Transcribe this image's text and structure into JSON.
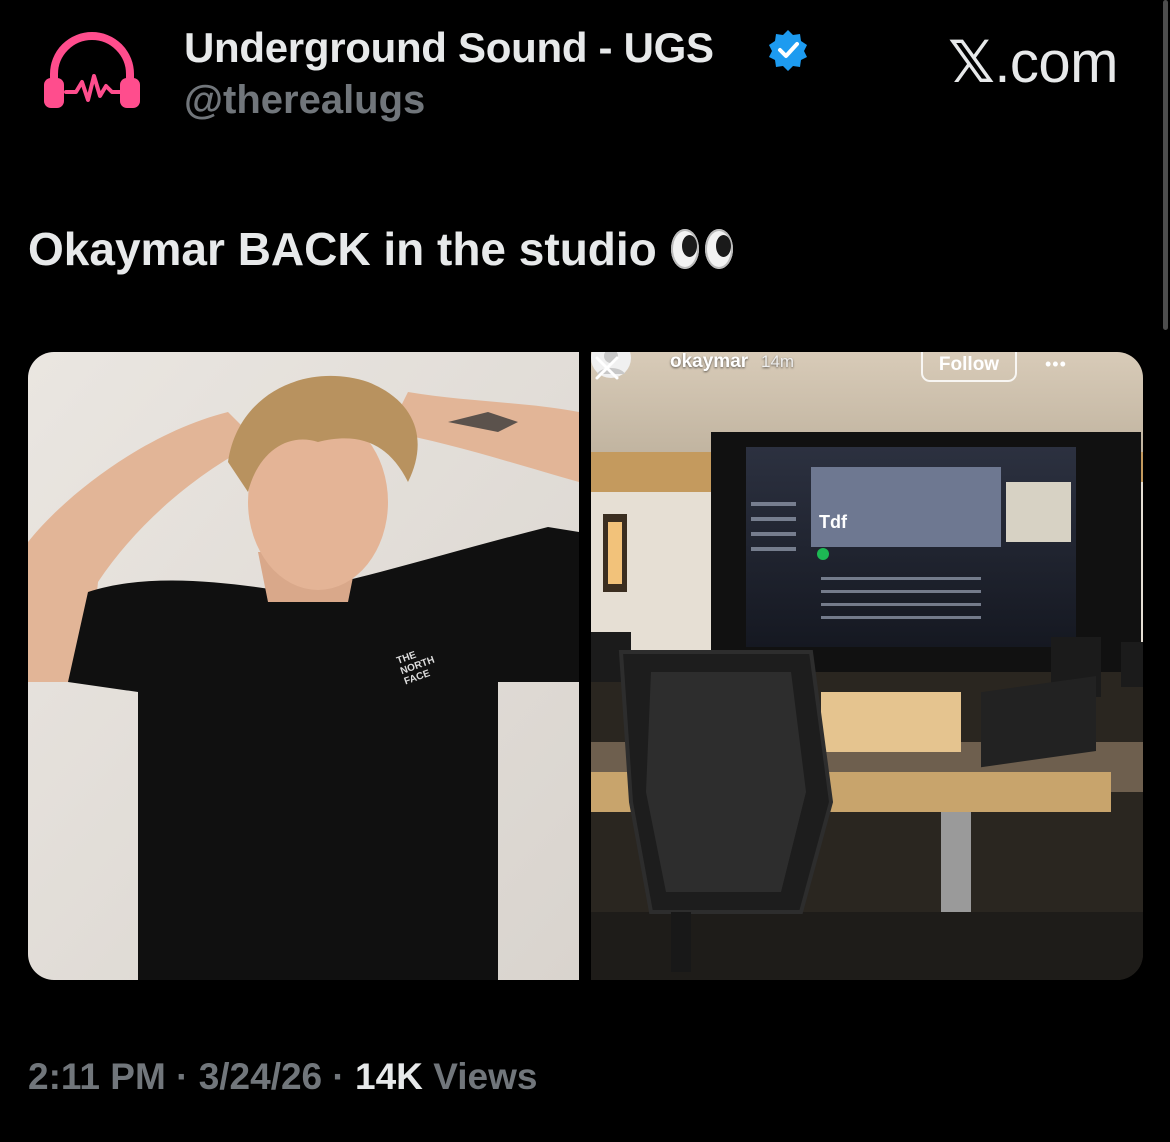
{
  "header": {
    "display_name": "Underground Sound - UGS",
    "handle": "@therealugs",
    "brand": "X.com",
    "avatar_icon": "headphones-waveform-icon",
    "verified_icon": "verified-badge-icon",
    "accent_color": "#ff4d8d",
    "verified_color": "#1d9bf0"
  },
  "tweet": {
    "text": "Okaymar BACK in the studio",
    "emoji": "eyes-emoji"
  },
  "media": {
    "left_photo": "man-in-black-north-face-tshirt-photo",
    "left_shirt_logo": "THE NORTH FACE",
    "right_photo": "recording-studio-story-screenshot",
    "story": {
      "username": "okaymar",
      "time": "14m",
      "follow_label": "Follow",
      "screen_title": "Tdf"
    }
  },
  "meta": {
    "time": "2:11 PM",
    "separator": " · ",
    "date": "3/24/26",
    "views_count": "14K",
    "views_label": "Views"
  }
}
